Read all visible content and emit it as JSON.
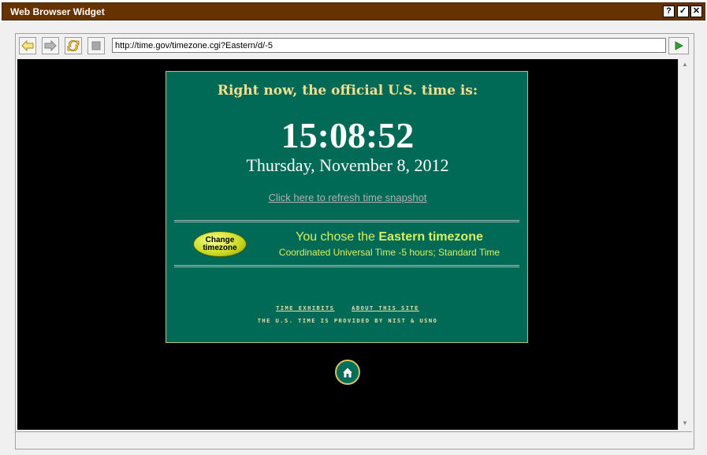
{
  "window": {
    "title": "Web Browser Widget",
    "help_label": "?",
    "ok_label": "✓",
    "close_label": "✕"
  },
  "toolbar": {
    "back_icon": "back-arrow-icon",
    "forward_icon": "forward-arrow-icon",
    "refresh_icon": "refresh-icon",
    "stop_icon": "stop-icon",
    "url": "http://time.gov/timezone.cgi?Eastern/d/-5",
    "go_icon": "go-play-icon"
  },
  "page": {
    "headline": "Right now, the official U.S. time is:",
    "time": "15:08:52",
    "date": "Thursday, November 8, 2012",
    "refresh_link": "Click here to refresh time snapshot",
    "change_tz_line1": "Change",
    "change_tz_line2": "timezone",
    "tz_prefix": "You chose the ",
    "tz_name": "Eastern timezone",
    "tz_detail": "Coordinated Universal Time -5 hours; Standard Time",
    "link_exhibits": "TIME EXHIBITS",
    "link_about": "ABOUT THIS SITE",
    "provided_by": "THE U.S. TIME IS PROVIDED BY NIST & USNO"
  },
  "colors": {
    "titlebar": "#663300",
    "page_bg": "#000000",
    "timebox_bg": "#006a56",
    "headline": "#f2e090",
    "tz_text": "#d8f060"
  }
}
